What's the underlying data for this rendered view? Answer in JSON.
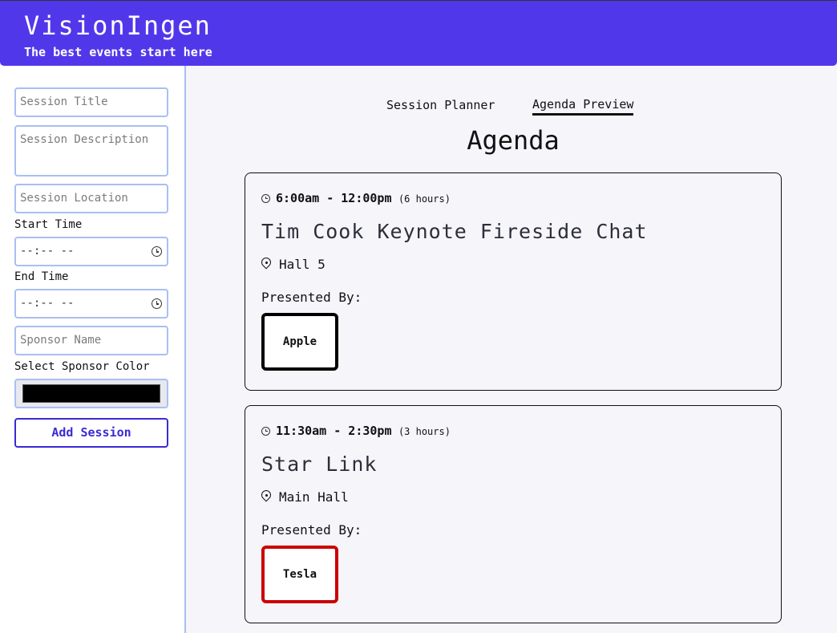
{
  "header": {
    "brand": "VisionIngen",
    "tagline": "The best events start here",
    "background": "#5038ea"
  },
  "form": {
    "title_placeholder": "Session Title",
    "description_placeholder": "Session Description",
    "location_placeholder": "Session Location",
    "start_label": "Start Time",
    "start_value": "--:-- --",
    "end_label": "End Time",
    "end_value": "--:-- --",
    "sponsor_placeholder": "Sponsor Name",
    "color_label": "Select Sponsor Color",
    "color_value": "#000000",
    "add_button": "Add Session"
  },
  "tabs": [
    {
      "label": "Session Planner",
      "active": false
    },
    {
      "label": "Agenda Preview",
      "active": true
    }
  ],
  "agenda": {
    "title": "Agenda",
    "presented_by_label": "Presented By:",
    "sessions": [
      {
        "time": "6:00am - 12:00pm",
        "duration": "(6 hours)",
        "title": "Tim Cook Keynote Fireside Chat",
        "location": "Hall 5",
        "sponsor": "Apple",
        "sponsor_color": "#000000"
      },
      {
        "time": "11:30am - 2:30pm",
        "duration": "(3 hours)",
        "title": "Star Link",
        "location": "Main Hall",
        "sponsor": "Tesla",
        "sponsor_color": "#cc0000"
      }
    ]
  }
}
